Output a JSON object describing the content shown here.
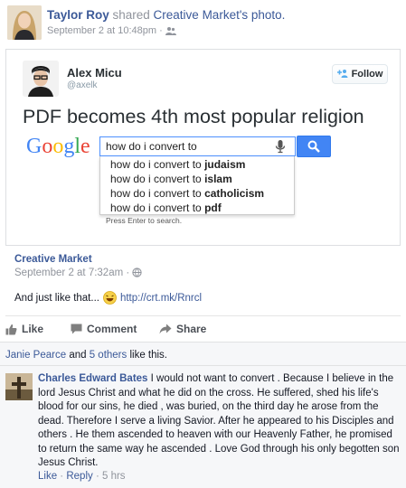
{
  "header": {
    "name": "Taylor Roy",
    "verb": " shared ",
    "object": "Creative Market's photo.",
    "date": "September 2 at 10:48pm",
    "sep": " · "
  },
  "tweet": {
    "name": "Alex Micu",
    "handle": "@axelk",
    "follow_label": "Follow",
    "text": "PDF becomes 4th most popular religion"
  },
  "google": {
    "logo": [
      "G",
      "o",
      "o",
      "g",
      "l",
      "e"
    ],
    "query": "how do i convert to",
    "suggestions": [
      {
        "prefix": "how do i convert to ",
        "bold": "judaism"
      },
      {
        "prefix": "how do i convert to ",
        "bold": "islam"
      },
      {
        "prefix": "how do i convert to ",
        "bold": "catholicism"
      },
      {
        "prefix": "how do i convert to ",
        "bold": "pdf"
      }
    ],
    "press_enter": "Press Enter to search."
  },
  "post": {
    "page_name": "Creative Market",
    "date": "September 2 at 7:32am",
    "sep": " · ",
    "body_text": "And just like that...",
    "link": "http://crt.mk/Rnrcl"
  },
  "actions": {
    "like": "Like",
    "comment": "Comment",
    "share": "Share"
  },
  "likes": {
    "person": "Janie Pearce",
    "and": " and ",
    "others": "5 others",
    "suffix": " like this."
  },
  "comment": {
    "author": "Charles Edward Bates",
    "text": "I would not want to convert . Because I believe in the lord Jesus Christ and what he did on the cross. He suffered, shed his life's blood for our sins, he died , was buried, on the third day he arose from the dead. Therefore I serve a living Savior. After he appeared to his Disciples and others . He them ascended to heaven with our Heavenly Father, he promised to return the same way he ascended . Love God through his only begotten son Jesus Christ.",
    "like": "Like",
    "reply": "Reply",
    "time": "5 hrs",
    "sep": " · "
  },
  "colors": {
    "fb_link": "#3b5998",
    "meta_grey": "#90949c",
    "twitter_blue": "#55acee",
    "google_blue": "#4285f4"
  }
}
